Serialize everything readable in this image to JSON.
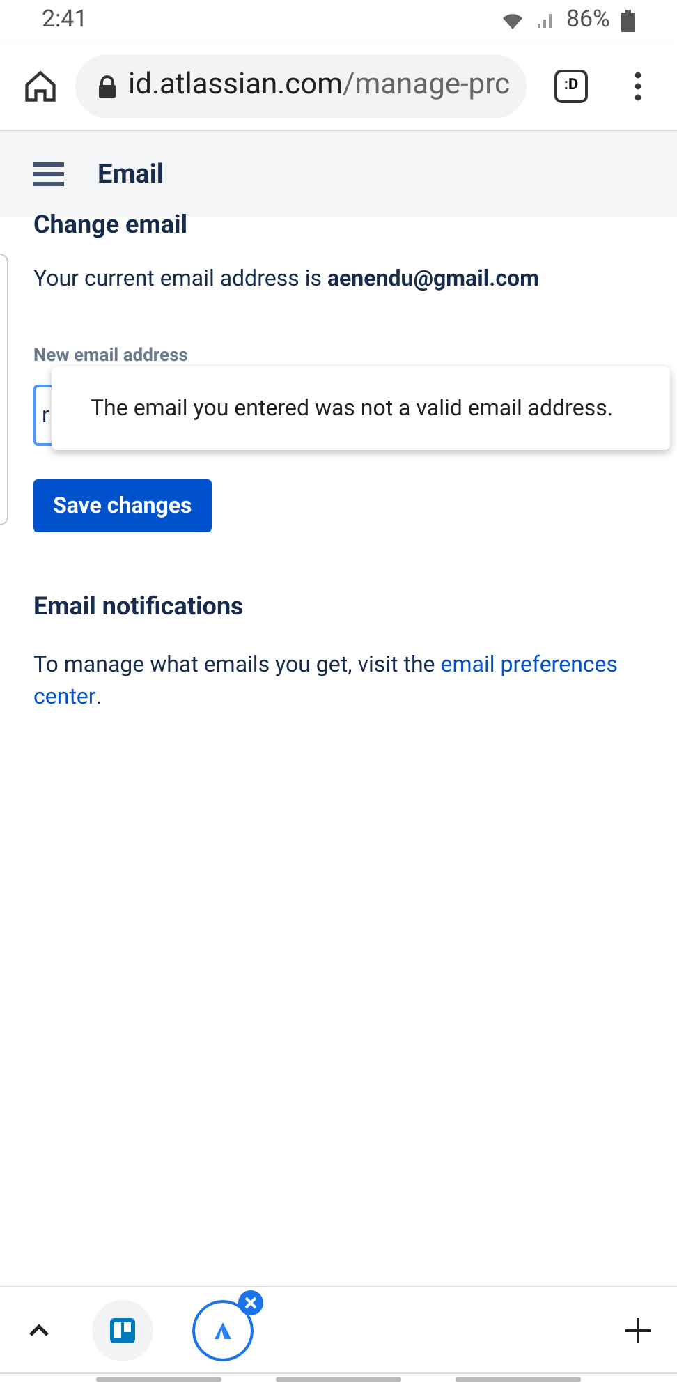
{
  "status_bar": {
    "time": "2:41",
    "battery": "86%"
  },
  "browser": {
    "url_host": "id.atlassian.com",
    "url_path": "/manage-prc",
    "tab_count": ":D"
  },
  "header": {
    "title": "Email"
  },
  "change_email": {
    "heading": "Change email",
    "current": "Your current email address is **aenendu@gmail.com**",
    "field_label": "New email address",
    "field_value": "r",
    "error": "The email you entered was not a valid email address.",
    "button": "Save changes"
  },
  "notifications": {
    "heading": "Email notifications",
    "text": "To manage what emails you get, visit the ",
    "link_lines": [
      "email preferences",
      "center"
    ],
    "end": "."
  },
  "tab_strip": [
    {
      "kind": "board",
      "selected": false
    },
    {
      "kind": "peak",
      "selected": true
    }
  ]
}
